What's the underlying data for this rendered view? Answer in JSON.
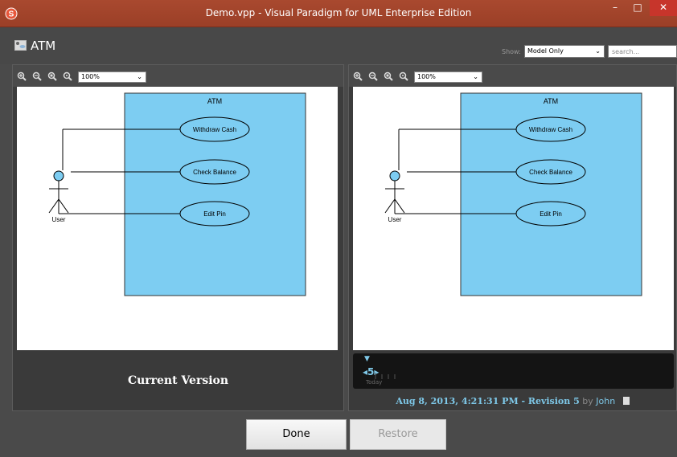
{
  "window": {
    "title": "Demo.vpp - Visual Paradigm for UML Enterprise Edition",
    "minimize": "–",
    "maximize": "□",
    "close": "✕"
  },
  "header": {
    "diagram_name": "ATM",
    "show_label": "Show:",
    "show_value": "Model Only",
    "search_placeholder": "search..."
  },
  "left_panel": {
    "zoom": "100%",
    "caption": "Current Version",
    "diagram": {
      "system_name": "ATM",
      "actor": "User",
      "use_cases": [
        "Withdraw Cash",
        "Check Balance",
        "Edit Pin"
      ]
    }
  },
  "right_panel": {
    "zoom": "100%",
    "diagram": {
      "system_name": "ATM",
      "actor": "User",
      "use_cases": [
        "Withdraw Cash",
        "Check Balance",
        "Edit Pin"
      ]
    },
    "timeline": {
      "revision_number": "5",
      "today_label": "Today"
    },
    "revision": {
      "date": "Aug 8, 2013, 4:21:31 PM - Revision 5",
      "by": "by",
      "user": "John"
    }
  },
  "buttons": {
    "done": "Done",
    "restore": "Restore"
  },
  "colors": {
    "title_bar": "#a9492f",
    "system_boundary": "#7dcdf2",
    "accent": "#7ec8e8"
  }
}
